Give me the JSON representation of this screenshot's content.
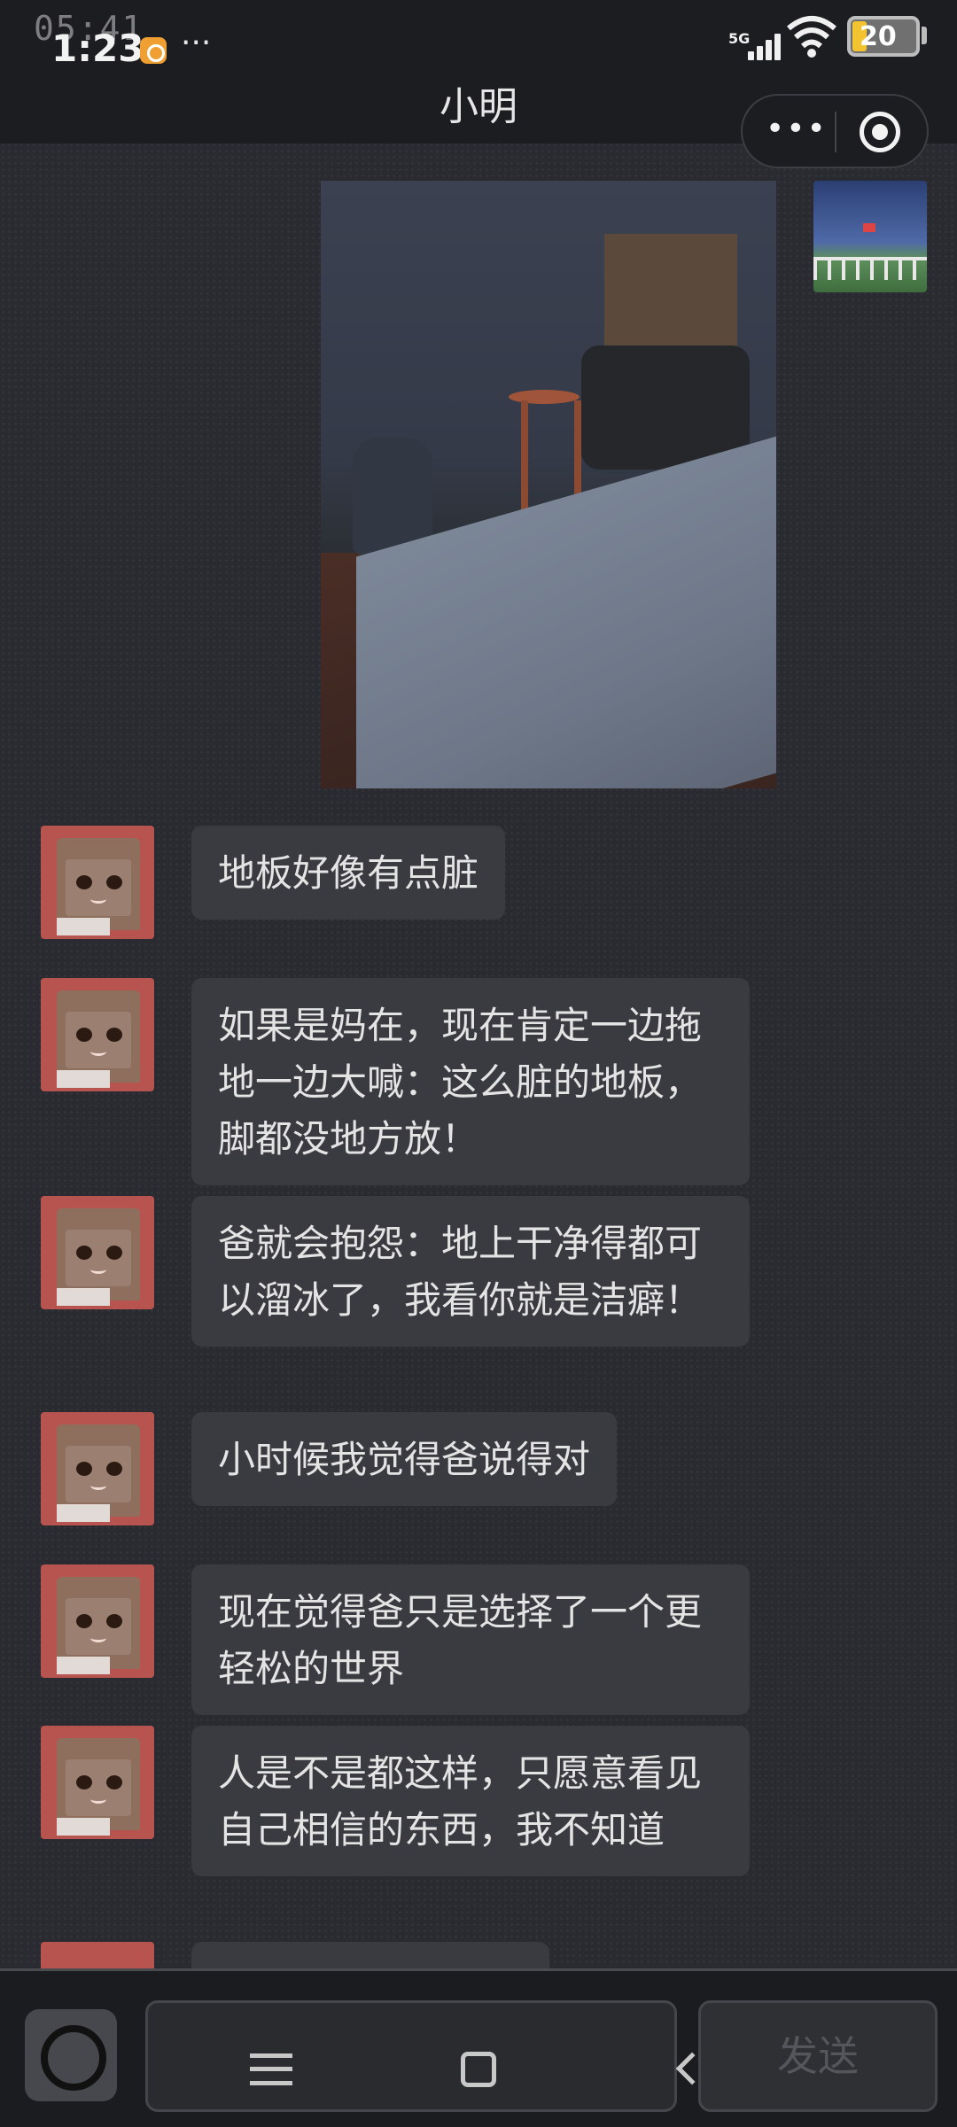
{
  "status": {
    "time_ghost": "05:41",
    "time": "1:23",
    "dots": "···",
    "network": "5G",
    "battery": "20"
  },
  "header": {
    "title": "小明",
    "more_label": "•••"
  },
  "messages": [
    {
      "text": "地板好像有点脏"
    },
    {
      "text": "如果是妈在，现在肯定一边拖地一边大喊：这么脏的地板，脚都没地方放！"
    },
    {
      "text": "爸就会抱怨：地上干净得都可以溜冰了，我看你就是洁癖！"
    },
    {
      "text": "小时候我觉得爸说得对"
    },
    {
      "text": "现在觉得爸只是选择了一个更轻松的世界"
    },
    {
      "text": "人是不是都这样，只愿意看见自己相信的东西，我不知道"
    }
  ],
  "composer": {
    "send_label": "发送"
  },
  "colors": {
    "background": "#2a2b30",
    "bubble": "#3a3b40",
    "avatar_red": "#b85450"
  }
}
